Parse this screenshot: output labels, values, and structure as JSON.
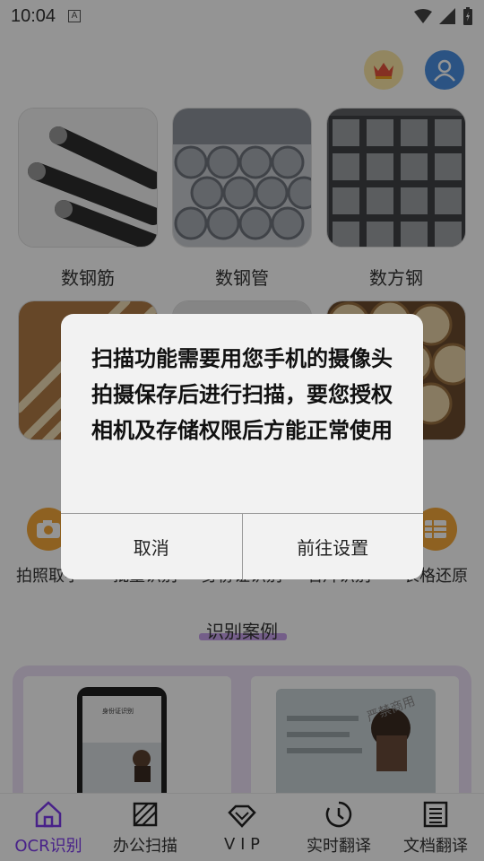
{
  "status_bar": {
    "time": "10:04",
    "notification_letter": "A"
  },
  "steel_items": [
    {
      "label": "数钢筋",
      "icon": "rebar-photo"
    },
    {
      "label": "数钢管",
      "icon": "steel-pipe-photo"
    },
    {
      "label": "数方钢",
      "icon": "square-steel-photo"
    },
    {
      "label": "",
      "icon": "wood-sticks-photo"
    },
    {
      "label": "",
      "icon": "tube-photo"
    },
    {
      "label": "",
      "icon": "log-ends-photo"
    }
  ],
  "tools": [
    {
      "label": "拍照取字",
      "icon": "camera-icon"
    },
    {
      "label": "批量识别",
      "icon": "batch-icon"
    },
    {
      "label": "身份证识别",
      "icon": "id-card-icon"
    },
    {
      "label": "名片识别",
      "icon": "business-card-icon"
    },
    {
      "label": "表格还原",
      "icon": "table-icon"
    }
  ],
  "cases": {
    "title": "识别案例",
    "watermark": "严禁商用",
    "phone_screen_title": "身份证识别"
  },
  "bottom_nav": [
    {
      "label": "OCR识别",
      "icon": "home-icon",
      "active": true
    },
    {
      "label": "办公扫描",
      "icon": "scan-icon",
      "active": false
    },
    {
      "label": "V I P",
      "icon": "diamond-icon",
      "active": false
    },
    {
      "label": "实时翻译",
      "icon": "clock-icon",
      "active": false
    },
    {
      "label": "文档翻译",
      "icon": "document-icon",
      "active": false
    }
  ],
  "dialog": {
    "message": "扫描功能需要用您手机的摄像头拍摄保存后进行扫描，要您授权相机及存储权限后方能正常使用",
    "cancel_label": "取消",
    "settings_label": "前往设置"
  },
  "colors": {
    "accent": "#7c3aed",
    "tool_orange": "#f4a83a",
    "avatar_blue": "#4a90e2"
  }
}
